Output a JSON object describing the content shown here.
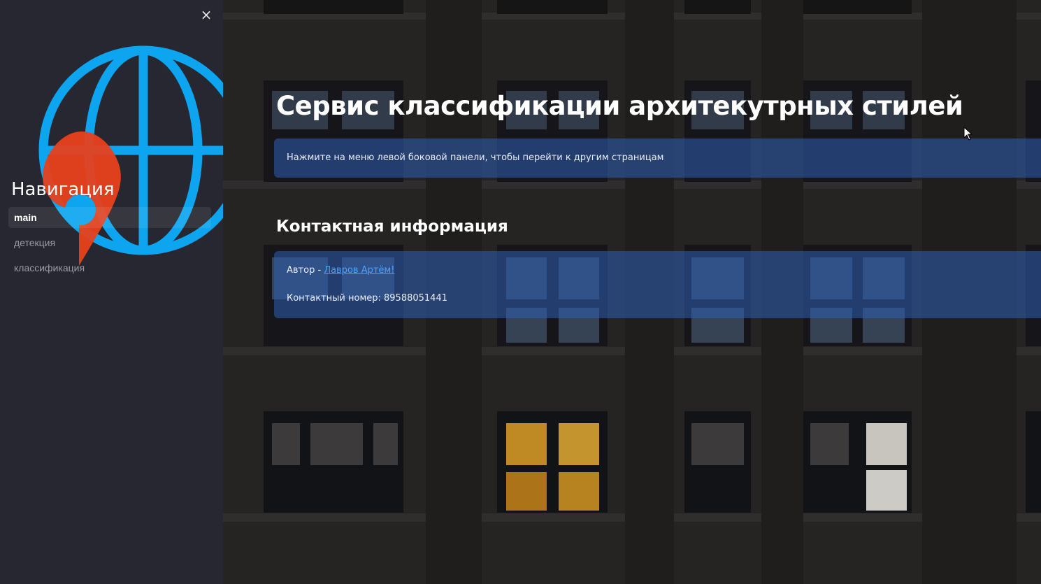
{
  "sidebar": {
    "close_label": "×",
    "nav_title": "Навигация",
    "items": [
      {
        "label": "main",
        "active": true
      },
      {
        "label": "детекция",
        "active": false
      },
      {
        "label": "классификация",
        "active": false
      }
    ],
    "logo_icon": "globe-with-location-pin-icon"
  },
  "main": {
    "title": "Сервис классификации архитекутрных стилей",
    "info": "Нажмите на меню левой боковой панели, чтобы перейти к другим страницам",
    "contacts_heading": "Контактная информация",
    "author_prefix": "Автор - ",
    "author_link": "Лавров Артём!",
    "phone": "Контактный номер: 89588051441"
  },
  "colors": {
    "sidebar_bg": "#262730",
    "globe": "#0ea5f0",
    "pin": "#e8401c",
    "info_box": "#2d5fb4",
    "link": "#4aa3ff"
  }
}
